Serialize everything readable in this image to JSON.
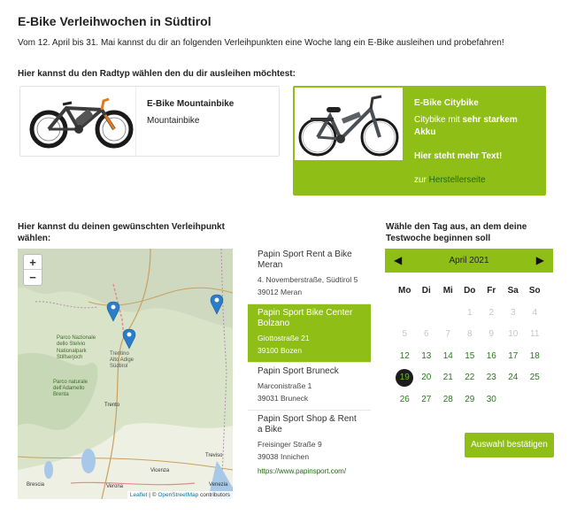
{
  "title": "E-Bike Verleihwochen in Südtirol",
  "intro": "Vom 12. April bis 31. Mai kannst du dir an folgenden Verleihpunkten eine Woche lang ein E-Bike ausleihen und probefahren!",
  "bike_section_title": "Hier kannst du den Radtyp wählen den du dir ausleihen möchtest:",
  "bikes": [
    {
      "name": "E-Bike Mountainbike",
      "desc": "Mountainbike"
    },
    {
      "name": "E-Bike Citybike",
      "desc_prefix": "Citybike mit ",
      "desc_bold": "sehr starkem Akku",
      "more": "Hier steht mehr Text!",
      "link_prefix": "zur ",
      "link_label": "Herstellerseite"
    }
  ],
  "location_section_title": "Hier kannst du deinen gewünschten Verleihpunkt wählen:",
  "map": {
    "zoom_in": "+",
    "zoom_out": "−",
    "attribution_leaflet": "Leaflet",
    "attribution_sep": " | © ",
    "attribution_osm": "OpenStreetMap",
    "attribution_suffix": " contributors",
    "labels": [
      "Parco Nazionale",
      "dello Stelvio",
      "Nationalpark",
      "Stilfserjoch",
      "Parco naturale",
      "dell'Adamello",
      "Brenta",
      "Trentino",
      "Alto Adige",
      "Südtirol",
      "Trento",
      "Vicenza",
      "Venezia",
      "Treviso",
      "Verona",
      "Brescia"
    ]
  },
  "locations": [
    {
      "name": "Papin Sport Rent a Bike Meran",
      "street": "4. Novemberstraße, Südtirol 5",
      "city": "39012 Meran"
    },
    {
      "name": "Papin Sport Bike Center Bolzano",
      "street": "Giottostraße 21",
      "city": "39100 Bozen"
    },
    {
      "name": "Papin Sport Bruneck",
      "street": "Marconistraße 1",
      "city": "39031 Bruneck"
    },
    {
      "name": "Papin Sport Shop & Rent a Bike",
      "street": "Freisinger Straße 9",
      "city": "39038 Innichen",
      "url": "https://www.papinsport.com/"
    }
  ],
  "calendar_section_title": "Wähle den Tag aus, an dem deine Testwoche beginnen soll",
  "calendar": {
    "month": "April 2021",
    "weekdays": [
      "Mo",
      "Di",
      "Mi",
      "Do",
      "Fr",
      "Sa",
      "So"
    ],
    "rows": [
      [
        "",
        "",
        "",
        "1",
        "2",
        "3",
        "4"
      ],
      [
        "5",
        "6",
        "7",
        "8",
        "9",
        "10",
        "11"
      ],
      [
        "12",
        "13",
        "14",
        "15",
        "16",
        "17",
        "18"
      ],
      [
        "19",
        "20",
        "21",
        "22",
        "23",
        "24",
        "25"
      ],
      [
        "26",
        "27",
        "28",
        "29",
        "30",
        "",
        ""
      ]
    ],
    "first_active_day": 12,
    "today": 19
  },
  "confirm_label": "Auswahl bestätigen",
  "colors": {
    "accent": "#8fbe16",
    "link": "#226a12",
    "disabled": "#c6c6c6",
    "marker": "#2a7dc9"
  }
}
